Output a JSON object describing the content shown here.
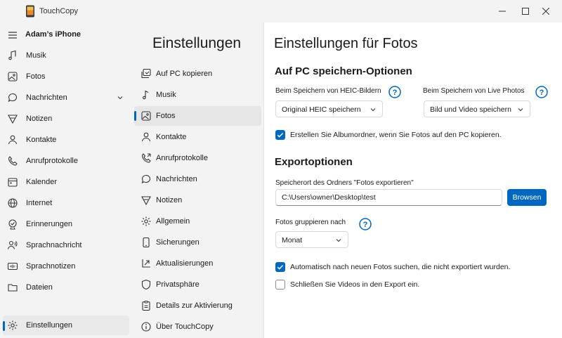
{
  "window": {
    "title": "TouchCopy",
    "icons": [
      "phone-app-icon",
      "minimize-icon",
      "maximize-icon",
      "close-icon"
    ]
  },
  "device": {
    "name": "Adam’s iPhone"
  },
  "leftnav": {
    "items": [
      {
        "label": "Musik",
        "icon": "music-note-icon"
      },
      {
        "label": "Fotos",
        "icon": "photo-icon"
      },
      {
        "label": "Nachrichten",
        "icon": "message-icon"
      },
      {
        "label": "Notizen",
        "icon": "notes-icon"
      },
      {
        "label": "Kontakte",
        "icon": "contact-icon"
      },
      {
        "label": "Anrufprotokolle",
        "icon": "phone-icon"
      },
      {
        "label": "Kalender",
        "icon": "calendar-icon"
      },
      {
        "label": "Internet",
        "icon": "globe-icon"
      },
      {
        "label": "Erinnerungen",
        "icon": "reminder-icon"
      },
      {
        "label": "Sprachnachricht",
        "icon": "voicemail-icon"
      },
      {
        "label": "Sprachnotizen",
        "icon": "voice-memo-icon"
      },
      {
        "label": "Dateien",
        "icon": "folder-icon"
      }
    ],
    "settings_label": "Einstellungen"
  },
  "settings_nav": {
    "title": "Einstellungen",
    "items": [
      {
        "label": "Auf PC kopieren",
        "icon": "copy-to-pc-icon"
      },
      {
        "label": "Musik",
        "icon": "music-note-icon"
      },
      {
        "label": "Fotos",
        "icon": "photo-icon"
      },
      {
        "label": "Kontakte",
        "icon": "contact-icon"
      },
      {
        "label": "Anrufprotokolle",
        "icon": "phone-icon"
      },
      {
        "label": "Nachrichten",
        "icon": "message-icon"
      },
      {
        "label": "Notizen",
        "icon": "notes-icon"
      },
      {
        "label": "Allgemein",
        "icon": "gear-icon"
      },
      {
        "label": "Sicherungen",
        "icon": "device-icon"
      },
      {
        "label": "Aktualisierungen",
        "icon": "update-icon"
      },
      {
        "label": "Privatsphäre",
        "icon": "shield-icon"
      },
      {
        "label": "Details zur Aktivierung",
        "icon": "clipboard-icon"
      },
      {
        "label": "Über TouchCopy",
        "icon": "info-icon"
      }
    ]
  },
  "content": {
    "title": "Einstellungen für Fotos",
    "save_section": {
      "title": "Auf PC speichern-Optionen",
      "heic_label": "Beim Speichern von HEIC-Bildern",
      "heic_value": "Original HEIC speichern",
      "live_label": "Beim Speichern von Live Photos",
      "live_value": "Bild und Video speichern",
      "album_folders_label": "Erstellen Sie Albumordner, wenn Sie Fotos auf den PC kopieren."
    },
    "export_section": {
      "title": "Exportoptionen",
      "location_label": "Speicherort des Ordners \"Fotos exportieren\"",
      "location_value": "C:\\Users\\owner\\Desktop\\test",
      "browse_label": "Browsen",
      "group_label": "Fotos gruppieren nach",
      "group_value": "Monat",
      "auto_search_label": "Automatisch nach neuen Fotos suchen, die nicht exportiert wurden.",
      "include_videos_label": "Schließen Sie Videos in den Export ein."
    }
  },
  "colors": {
    "accent": "#0067c0"
  }
}
